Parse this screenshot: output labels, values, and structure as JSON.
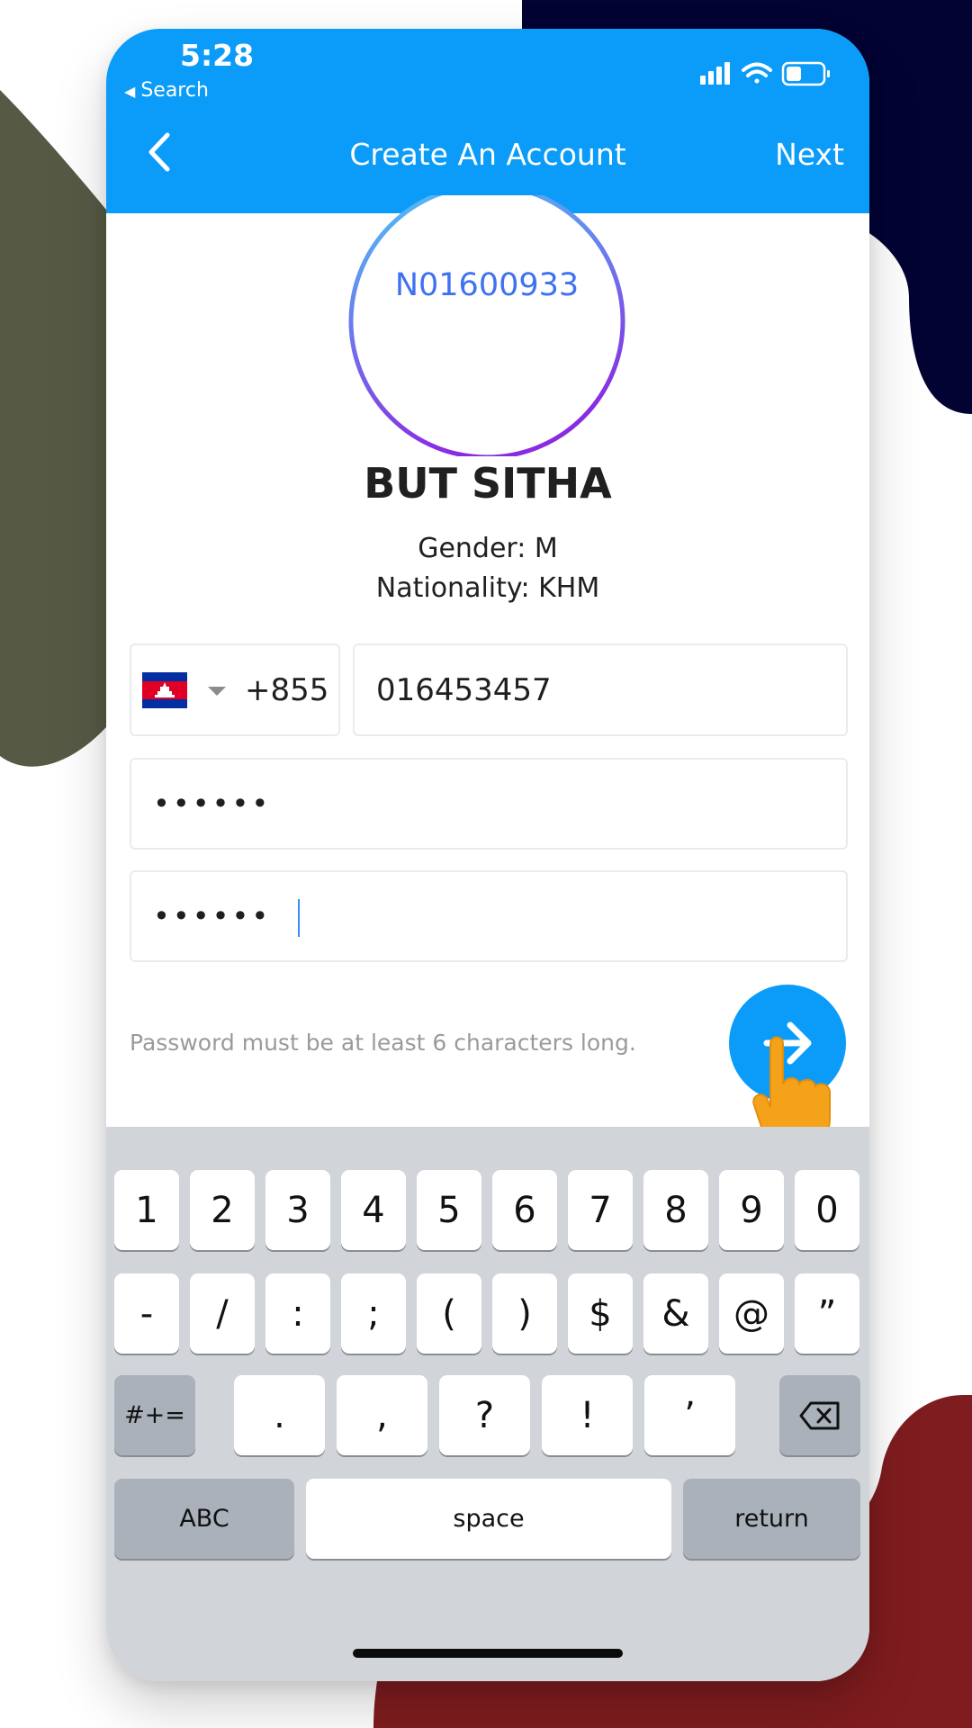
{
  "status_bar": {
    "time": "5:28",
    "back_label": "Search"
  },
  "nav": {
    "title": "Create An Account",
    "next_label": "Next"
  },
  "profile": {
    "id": "N01600933",
    "name": "BUT SITHA",
    "gender": "Gender: M",
    "nationality": "Nationality: KHM"
  },
  "form": {
    "country_code": "+855",
    "phone": "016453457",
    "password": "••••••",
    "confirm_password": "••••••",
    "hint": "Password must be at least 6 characters long."
  },
  "keyboard": {
    "row1": [
      "1",
      "2",
      "3",
      "4",
      "5",
      "6",
      "7",
      "8",
      "9",
      "0"
    ],
    "row2": [
      "-",
      "/",
      ":",
      ";",
      "(",
      ")",
      "$",
      "&",
      "@",
      "”"
    ],
    "row3": [
      ".",
      ",",
      "?",
      "!",
      "’"
    ],
    "symbols_label": "#+=",
    "abc_label": "ABC",
    "space_label": "space",
    "return_label": "return"
  },
  "colors": {
    "brand_blue": "#0a9cf8",
    "id_text": "#3f72f0",
    "ring_start": "#4fc6f7",
    "ring_end": "#8a2be2",
    "hand": "#f5a21b"
  },
  "icons": [
    "signal-icon",
    "wifi-icon",
    "battery-icon",
    "back-chevron-icon",
    "flag-cambodia-icon",
    "dropdown-caret-icon",
    "arrow-right-icon",
    "hand-pointer-icon",
    "backspace-icon"
  ]
}
